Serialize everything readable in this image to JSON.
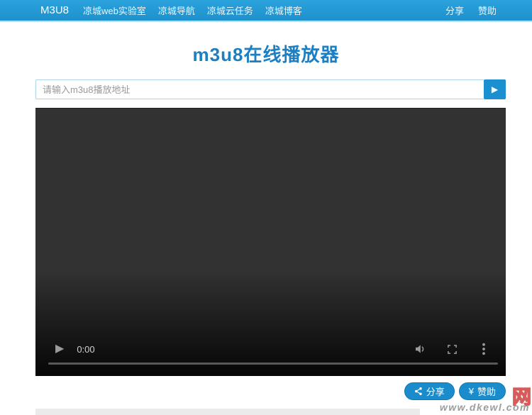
{
  "navbar": {
    "brand": "M3U8",
    "items": [
      "凉城web实验室",
      "凉城导航",
      "凉城云任务",
      "凉城博客"
    ],
    "right_items": [
      "分享",
      "赞助"
    ]
  },
  "page": {
    "title": "m3u8在线播放器"
  },
  "form": {
    "placeholder": "请输入m3u8播放地址",
    "value": ""
  },
  "video": {
    "current_time": "0:00"
  },
  "actions": {
    "share_label": "分享",
    "donate_label": "赞助"
  },
  "watermark": {
    "char": "网",
    "url": "www.dkewl.com"
  },
  "icons": {
    "play": "▶",
    "yen": "¥"
  },
  "colors": {
    "navbar_blue": "#1e91cd",
    "title_blue": "#1d7fc1",
    "button_blue": "#1c8fd1",
    "pill_blue": "#1b8ccb",
    "video_bg": "#323232",
    "watermark_red": "#cf4040",
    "footer_gray": "#ebebeb"
  }
}
